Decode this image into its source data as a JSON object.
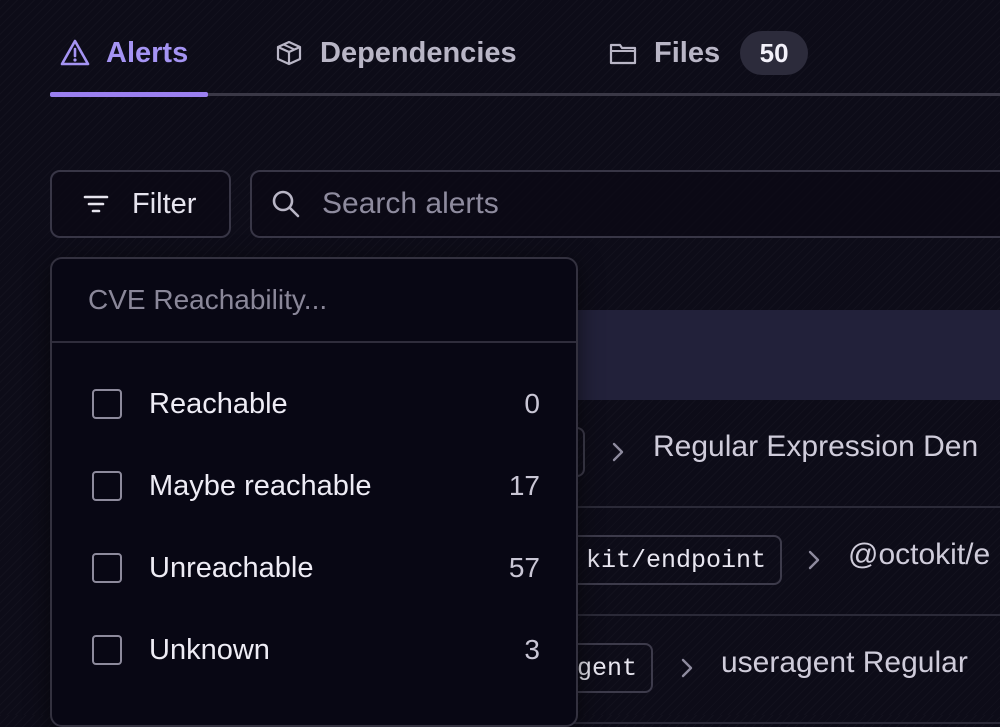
{
  "tabs": [
    {
      "label": "Alerts",
      "icon": "warning-triangle-icon",
      "active": true
    },
    {
      "label": "Dependencies",
      "icon": "package-cube-icon",
      "active": false
    },
    {
      "label": "Files",
      "icon": "folder-icon",
      "active": false,
      "count": "50"
    }
  ],
  "toolbar": {
    "filter_label": "Filter",
    "filter_icon": "filter-lines-icon",
    "search_placeholder": "Search alerts",
    "search_icon": "search-icon"
  },
  "dropdown": {
    "search_placeholder": "CVE Reachability...",
    "options": [
      {
        "label": "Reachable",
        "count": "0",
        "checked": false
      },
      {
        "label": "Maybe reachable",
        "count": "17",
        "checked": false
      },
      {
        "label": "Unreachable",
        "count": "57",
        "checked": false
      },
      {
        "label": "Unknown",
        "count": "3",
        "checked": false
      }
    ]
  },
  "table": {
    "rows": [
      {
        "package": "",
        "title": "Regular Expression Den"
      },
      {
        "package": "kit/endpoint",
        "title": "@octokit/e"
      },
      {
        "package": "gent",
        "title": "useragent Regular"
      }
    ]
  },
  "colors": {
    "background": "#0d0c18",
    "accent": "#a594f3",
    "tab_active_bar": "#9b80f0",
    "dropdown_bg": "#080714",
    "table_header_bg": "#22213a"
  }
}
